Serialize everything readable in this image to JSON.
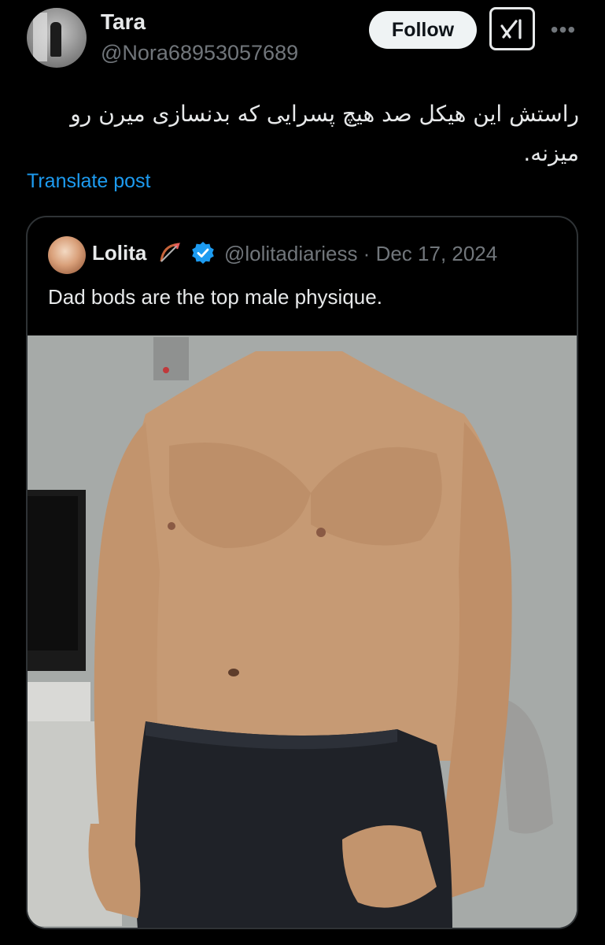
{
  "tweet": {
    "author_name": "Tara",
    "author_handle": "@Nora68953057689",
    "follow_label": "Follow",
    "more_label": "•••",
    "text": "راستش این هیکل صد هیچ پسرایی که بدنسازی میرن رو میزنه.",
    "translate_label": "Translate post"
  },
  "quoted": {
    "author_name": "Lolita",
    "emoji": "🏹",
    "verified": true,
    "meta": "@lolitadiariess · Dec 17, 2024",
    "text": "Dad bods are the top male physique."
  },
  "icons": {
    "grok": "grok-icon",
    "more": "more-icon",
    "verified": "verified-badge-icon",
    "bow": "bow-and-arrow-icon"
  },
  "colors": {
    "background": "#000000",
    "text": "#e7e9ea",
    "secondary": "#71767b",
    "link": "#1d9bf0",
    "verified": "#1d9bf0",
    "follow_bg": "#eff3f4"
  }
}
